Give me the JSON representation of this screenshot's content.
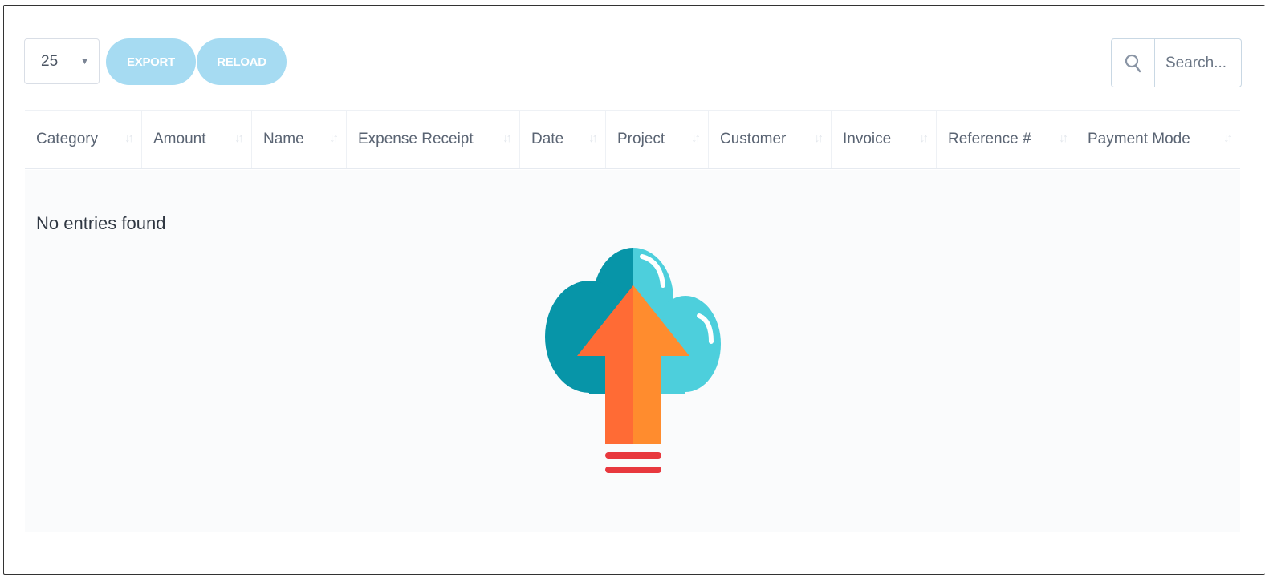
{
  "toolbar": {
    "page_length": "25",
    "export_label": "EXPORT",
    "reload_label": "RELOAD",
    "search_placeholder": "Search..."
  },
  "table": {
    "columns": [
      "Category",
      "Amount",
      "Name",
      "Expense Receipt",
      "Date",
      "Project",
      "Customer",
      "Invoice",
      "Reference #",
      "Payment Mode"
    ],
    "empty_message": "No entries found"
  },
  "icons": {
    "search": "search-icon",
    "sort": "sort-icon",
    "caret": "caret-down-icon",
    "empty": "cloud-upload-icon"
  },
  "colors": {
    "button_bg": "#a6dbf2",
    "cloud_dark": "#0795a8",
    "cloud_light": "#4dcfdc",
    "arrow_left": "#ff6b35",
    "arrow_right": "#ff8c2e",
    "arrow_base": "#e8383e"
  }
}
